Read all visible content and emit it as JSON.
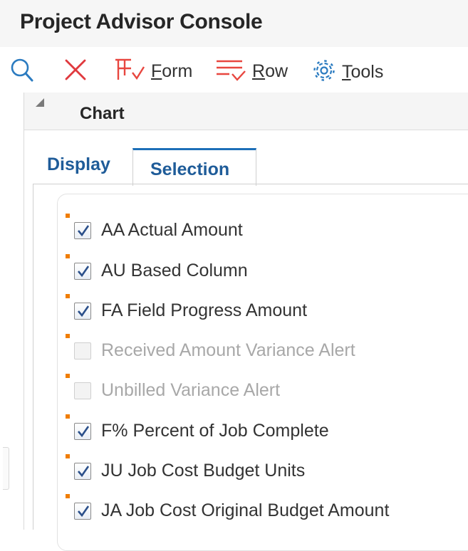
{
  "app": {
    "title": "Project Advisor Console"
  },
  "toolbar": {
    "form_label_first": "F",
    "form_label_rest": "orm",
    "row_label_first": "R",
    "row_label_rest": "ow",
    "tools_label_first": "T",
    "tools_label_rest": "ools",
    "icons": [
      "search-icon",
      "close-icon",
      "form-icon",
      "row-icon",
      "gear-icon"
    ]
  },
  "section": {
    "title": "Chart"
  },
  "tabs": [
    {
      "label": "Display",
      "active": false
    },
    {
      "label": "Selection",
      "active": true
    }
  ],
  "colors": {
    "accent": "#1d6fb8",
    "tab_text": "#1f5c99",
    "required_marker": "#f07d00",
    "close_icon": "#e0393e",
    "toolbar_icon_red": "#e8463f"
  },
  "options": [
    {
      "label": "AA Actual Amount",
      "checked": true,
      "enabled": true
    },
    {
      "label": "AU Based Column",
      "checked": true,
      "enabled": true
    },
    {
      "label": "FA Field Progress Amount",
      "checked": true,
      "enabled": true
    },
    {
      "label": "Received Amount Variance Alert",
      "checked": false,
      "enabled": false
    },
    {
      "label": "Unbilled Variance Alert",
      "checked": false,
      "enabled": false
    },
    {
      "label": "F% Percent of Job Complete",
      "checked": true,
      "enabled": true
    },
    {
      "label": "JU Job Cost Budget Units",
      "checked": true,
      "enabled": true
    },
    {
      "label": "JA Job Cost Original Budget Amount",
      "checked": true,
      "enabled": true
    }
  ]
}
